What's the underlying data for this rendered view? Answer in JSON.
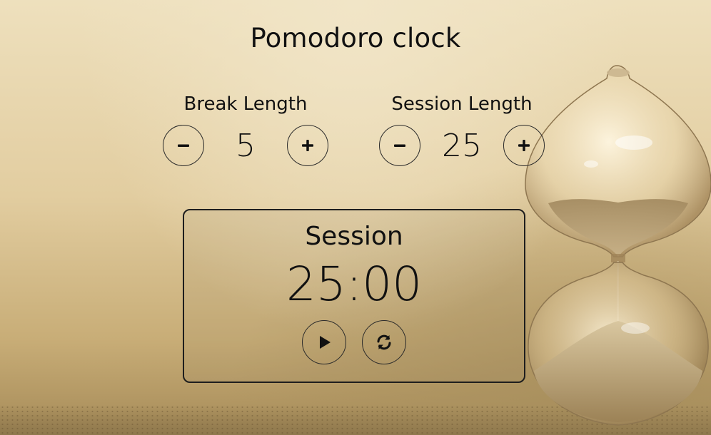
{
  "app": {
    "title": "Pomodoro clock"
  },
  "break": {
    "label": "Break Length",
    "value": "5",
    "decrement_icon": "minus-icon",
    "increment_icon": "plus-icon"
  },
  "session": {
    "label": "Session Length",
    "value": "25",
    "decrement_icon": "minus-icon",
    "increment_icon": "plus-icon"
  },
  "timer": {
    "label": "Session",
    "time": "25:00",
    "play_icon": "play-icon",
    "reset_icon": "refresh-icon"
  },
  "colors": {
    "text": "#111111",
    "border": "#1e1e1e"
  }
}
